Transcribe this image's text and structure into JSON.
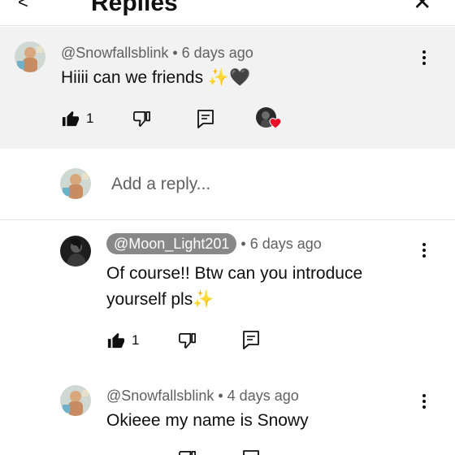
{
  "header": {
    "back_icon": "arrow-left-icon",
    "title": "Replies",
    "close_icon": "close-icon"
  },
  "parent_comment": {
    "author": "@Snowfallsblink",
    "time": "6 days ago",
    "text": "Hiiii can we friends ✨🖤",
    "likes": "1"
  },
  "reply_input": {
    "placeholder": "Add a reply..."
  },
  "replies": [
    {
      "author": "@Moon_Light201",
      "time": "6 days ago",
      "text_line1": "Of course!! Btw can you introduce",
      "text_line2": "yourself pls✨",
      "likes": "1"
    },
    {
      "author": "@Snowfallsblink",
      "time": "4 days ago",
      "text": "Okieee my name is Snowy"
    }
  ],
  "separator": "•",
  "colors": {
    "highlight_bg": "#f2f2f2",
    "mention_bg": "#888888",
    "heart": "#e8102a",
    "secondary_text": "#606060"
  }
}
